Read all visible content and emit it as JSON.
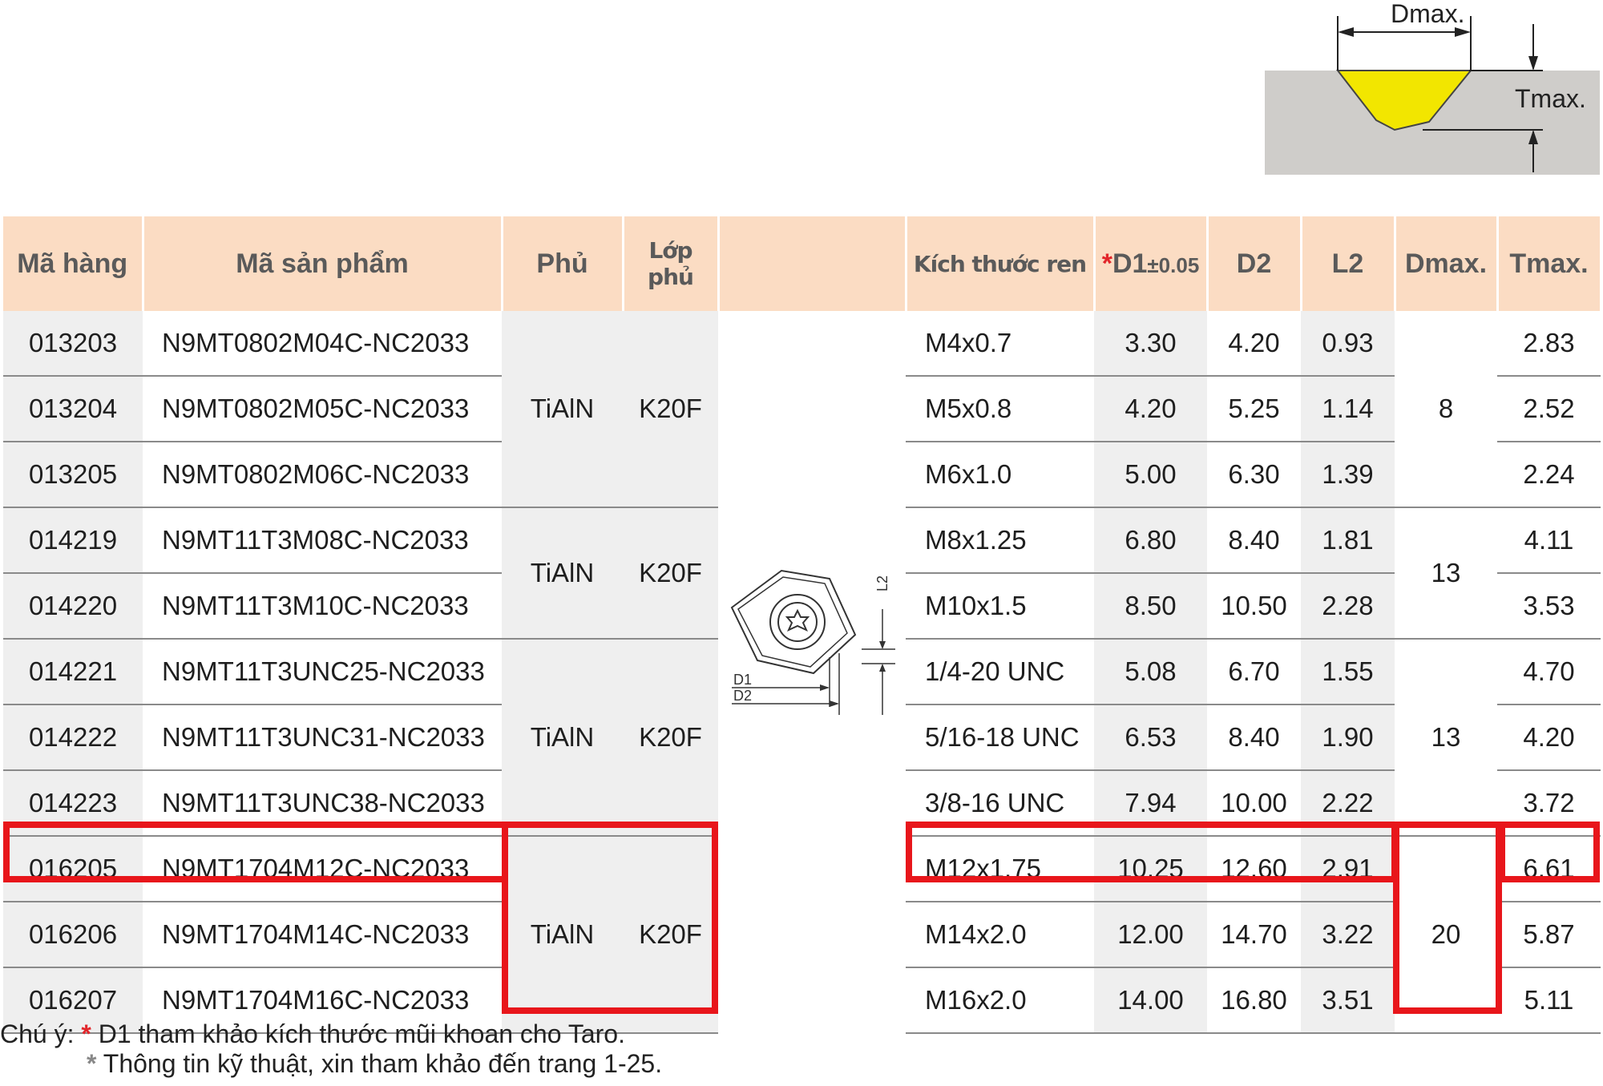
{
  "diagram": {
    "dmax_label": "Dmax.",
    "tmax_label": "Tmax.",
    "yellow": "#f2e600",
    "gray_block": "#cfcdca"
  },
  "headers": {
    "ma_hang": "Mã hàng",
    "ma_san_pham": "Mã sản phẩm",
    "phu": "Phủ",
    "lop_phu": "Lớp phủ",
    "figure": "",
    "kich_thuoc_ren": "Kích thước ren",
    "d1_star": "*",
    "d1": "D1",
    "d1_tol": "±0.05",
    "d2": "D2",
    "l2": "L2",
    "dmax": "Dmax.",
    "tmax": "Tmax."
  },
  "groups": [
    {
      "phu": "TiAlN",
      "lop_phu": "K20F",
      "dmax": "8"
    },
    {
      "phu": "TiAlN",
      "lop_phu": "K20F",
      "dmax": "13"
    },
    {
      "phu": "TiAlN",
      "lop_phu": "K20F",
      "dmax": "13"
    },
    {
      "phu": "TiAlN",
      "lop_phu": "K20F",
      "dmax": "20"
    }
  ],
  "rows": [
    {
      "ma_hang": "013203",
      "ma_san_pham": "N9MT0802M04C-NC2033",
      "ren": "M4x0.7",
      "d1": "3.30",
      "d2": "4.20",
      "l2": "0.93",
      "tmax": "2.83"
    },
    {
      "ma_hang": "013204",
      "ma_san_pham": "N9MT0802M05C-NC2033",
      "ren": "M5x0.8",
      "d1": "4.20",
      "d2": "5.25",
      "l2": "1.14",
      "tmax": "2.52"
    },
    {
      "ma_hang": "013205",
      "ma_san_pham": "N9MT0802M06C-NC2033",
      "ren": "M6x1.0",
      "d1": "5.00",
      "d2": "6.30",
      "l2": "1.39",
      "tmax": "2.24"
    },
    {
      "ma_hang": "014219",
      "ma_san_pham": "N9MT11T3M08C-NC2033",
      "ren": "M8x1.25",
      "d1": "6.80",
      "d2": "8.40",
      "l2": "1.81",
      "tmax": "4.11"
    },
    {
      "ma_hang": "014220",
      "ma_san_pham": "N9MT11T3M10C-NC2033",
      "ren": "M10x1.5",
      "d1": "8.50",
      "d2": "10.50",
      "l2": "2.28",
      "tmax": "3.53"
    },
    {
      "ma_hang": "014221",
      "ma_san_pham": "N9MT11T3UNC25-NC2033",
      "ren": "1/4-20 UNC",
      "d1": "5.08",
      "d2": "6.70",
      "l2": "1.55",
      "tmax": "4.70"
    },
    {
      "ma_hang": "014222",
      "ma_san_pham": "N9MT11T3UNC31-NC2033",
      "ren": "5/16-18 UNC",
      "d1": "6.53",
      "d2": "8.40",
      "l2": "1.90",
      "tmax": "4.20"
    },
    {
      "ma_hang": "014223",
      "ma_san_pham": "N9MT11T3UNC38-NC2033",
      "ren": "3/8-16 UNC",
      "d1": "7.94",
      "d2": "10.00",
      "l2": "2.22",
      "tmax": "3.72"
    },
    {
      "ma_hang": "016205",
      "ma_san_pham": "N9MT1704M12C-NC2033",
      "ren": "M12x1.75",
      "d1": "10.25",
      "d2": "12.60",
      "l2": "2.91",
      "tmax": "6.61"
    },
    {
      "ma_hang": "016206",
      "ma_san_pham": "N9MT1704M14C-NC2033",
      "ren": "M14x2.0",
      "d1": "12.00",
      "d2": "14.70",
      "l2": "3.22",
      "tmax": "5.87"
    },
    {
      "ma_hang": "016207",
      "ma_san_pham": "N9MT1704M16C-NC2033",
      "ren": "M16x2.0",
      "d1": "14.00",
      "d2": "16.80",
      "l2": "3.51",
      "tmax": "5.11"
    }
  ],
  "insert_figure": {
    "l2_label": "L2",
    "d1_label": "D1",
    "d2_label": "D2"
  },
  "highlight_color": "#e8161b",
  "footnote": {
    "prefix": "Chú ý:",
    "star": "*",
    "line1": "D1 tham khảo kích thước mũi khoan cho Taro.",
    "line2": "Thông tin kỹ thuật, xin tham khảo đến trang 1-25."
  }
}
